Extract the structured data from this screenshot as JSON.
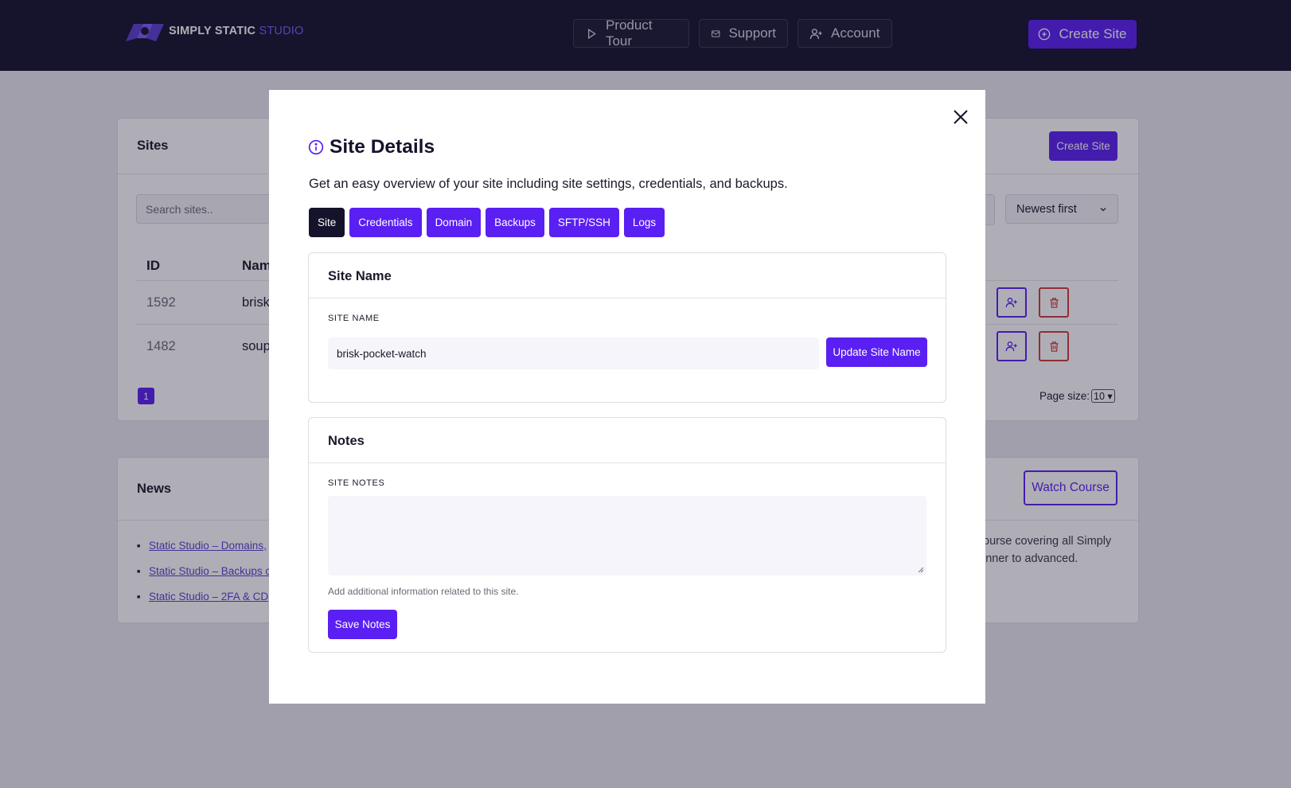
{
  "header": {
    "logo": {
      "brand": "SIMPLY STATIC",
      "product": "STUDIO"
    },
    "nav": [
      {
        "label": "Product Tour",
        "icon": "play-icon"
      },
      {
        "label": "Support",
        "icon": "mail-icon"
      },
      {
        "label": "Account",
        "icon": "user-plus-icon"
      }
    ],
    "create_site": "Create Site"
  },
  "sites_card": {
    "title": "Sites",
    "create_button": "Create Site",
    "search_placeholder": "Search sites..",
    "sort": "Newest first",
    "columns": [
      "ID",
      "Nam"
    ],
    "rows": [
      {
        "id": "1592",
        "name": "brisk"
      },
      {
        "id": "1482",
        "name": "soup"
      }
    ],
    "page": "1",
    "page_size_label": "Page size:",
    "page_size": "10"
  },
  "news_card": {
    "title": "News",
    "watch_button": "Watch Course",
    "items": [
      "Static Studio – Domains,",
      "Static Studio – Backups c",
      "Static Studio – 2FA & CD"
    ],
    "description": "ourse covering all Simply inner to advanced."
  },
  "modal": {
    "title": "Site Details",
    "subtitle": "Get an easy overview of your site including site settings, credentials, and backups.",
    "tabs": [
      "Site",
      "Credentials",
      "Domain",
      "Backups",
      "SFTP/SSH",
      "Logs"
    ],
    "active_tab": "Site",
    "site_name_panel": {
      "heading": "Site Name",
      "label": "SITE NAME",
      "value": "brisk-pocket-watch",
      "button": "Update Site Name"
    },
    "notes_panel": {
      "heading": "Notes",
      "label": "SITE NOTES",
      "value": "",
      "help": "Add additional information related to this site.",
      "button": "Save Notes"
    }
  },
  "colors": {
    "header_bg": "#15122b",
    "accent": "#5a1ff2",
    "danger": "#d13b3b"
  }
}
